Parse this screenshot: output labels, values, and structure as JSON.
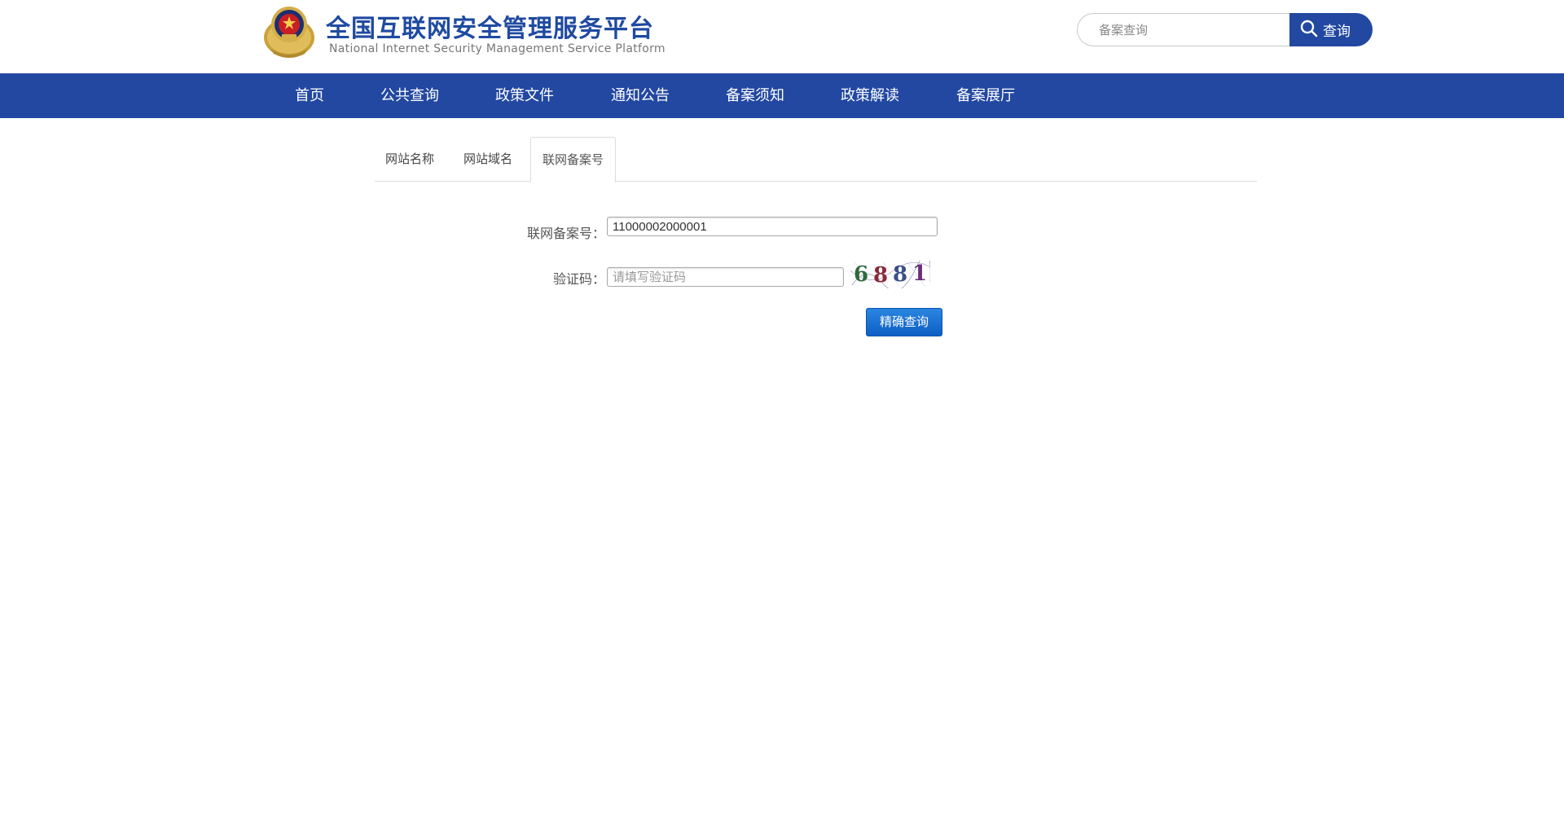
{
  "header": {
    "title_cn": "全国互联网安全管理服务平台",
    "title_en": "National Internet Security Management Service Platform",
    "search": {
      "placeholder": "备案查询",
      "button_label": "查询"
    }
  },
  "nav": {
    "items": [
      {
        "label": "首页"
      },
      {
        "label": "公共查询"
      },
      {
        "label": "政策文件"
      },
      {
        "label": "通知公告"
      },
      {
        "label": "备案须知"
      },
      {
        "label": "政策解读"
      },
      {
        "label": "备案展厅"
      }
    ]
  },
  "tabs": {
    "items": [
      {
        "label": "网站名称"
      },
      {
        "label": "网站域名"
      },
      {
        "label": "联网备案号"
      }
    ],
    "active_index": 2
  },
  "form": {
    "record_label": "联网备案号：",
    "record_value": "11000002000001",
    "captcha_label": "验证码：",
    "captcha_placeholder": "请填写验证码",
    "captcha_text": "6881",
    "submit_label": "精确查询"
  },
  "colors": {
    "brand_blue": "#2248a1",
    "button_blue": "#1a70d4"
  }
}
